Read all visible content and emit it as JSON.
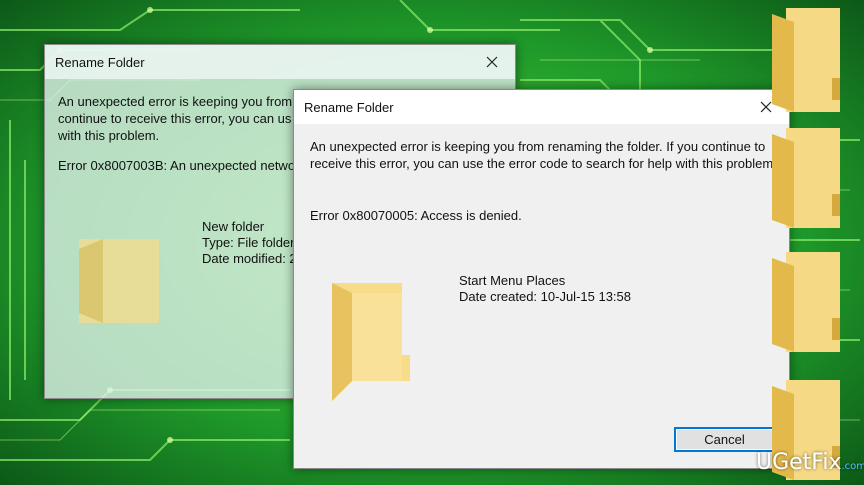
{
  "background_dialog": {
    "title": "Rename Folder",
    "message_lines": [
      "An unexpected error is keeping you from",
      "continue to receive this error, you can us",
      "with this problem."
    ],
    "error": "Error 0x8007003B: An unexpected network",
    "item_name": "New folder",
    "item_type": "Type: File folder",
    "item_date": "Date modified: 2"
  },
  "front_dialog": {
    "title": "Rename Folder",
    "message": "An unexpected error is keeping you from renaming the folder. If you continue to receive this error, you can use the error code to search for help with this problem.",
    "error": "Error 0x80070005: Access is denied.",
    "item_name": "Start Menu Places",
    "item_date": "Date created: 10-Jul-15 13:58",
    "cancel_label": "Cancel"
  },
  "watermark": {
    "brand": "UGetFix",
    "suffix": ".com"
  },
  "colors": {
    "background_green": "#1f8f2a",
    "folder_yellow": "#f5d580",
    "accent_blue": "#0078d7"
  },
  "icons": [
    "close-icon",
    "folder-icon"
  ]
}
